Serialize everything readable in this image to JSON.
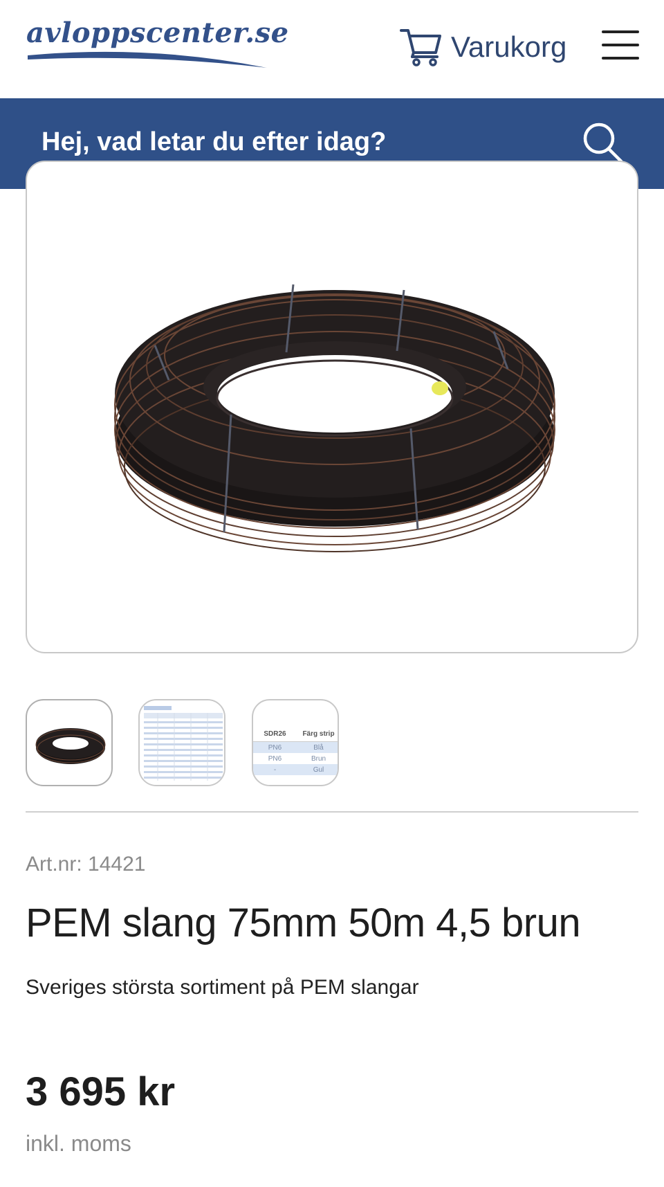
{
  "header": {
    "logo_text": "avloppscenter.se",
    "cart_label": "Varukorg"
  },
  "search": {
    "placeholder": "Hej, vad letar du efter idag?"
  },
  "thumbnails": {
    "spec_table": {
      "headers": [
        "SDR26",
        "Färg strip"
      ],
      "rows": [
        [
          "PN6",
          "Blå"
        ],
        [
          "PN6",
          "Brun"
        ],
        [
          "-",
          "Gul"
        ]
      ]
    }
  },
  "product": {
    "art_nr": "Art.nr: 14421",
    "title": "PEM slang 75mm 50m 4,5 brun",
    "description": "Sveriges största sortiment på PEM slangar",
    "price": "3 695 kr",
    "vat_note": "inkl. moms"
  },
  "colors": {
    "brand_blue": "#2f5088",
    "logo_blue": "#33518a",
    "text_dark": "#1e1e1e",
    "text_muted": "#8a8a8a"
  },
  "icons": [
    "cart-icon",
    "hamburger-menu-icon",
    "search-icon"
  ]
}
